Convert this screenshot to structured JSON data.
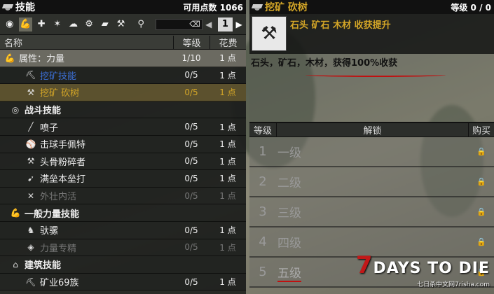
{
  "left": {
    "title": "技能",
    "points_label": "可用点数 1066",
    "page": "1",
    "headers": {
      "name": "名称",
      "level": "等级",
      "cost": "花费"
    },
    "rows": [
      {
        "name": "属性：力量",
        "level": "1/10",
        "cost": "1 点",
        "icon": "arm-icon",
        "type": "attr"
      },
      {
        "name": "挖矿技能",
        "level": "0/5",
        "cost": "1 点",
        "icon": "pickaxe-icon",
        "type": "blue"
      },
      {
        "name": "挖矿 砍树",
        "level": "0/5",
        "cost": "1 点",
        "icon": "axe-icon",
        "type": "gold"
      },
      {
        "name": "战斗技能",
        "level": "",
        "cost": "",
        "icon": "target-icon",
        "type": "cat"
      },
      {
        "name": "喷子",
        "level": "0/5",
        "cost": "1 点",
        "icon": "shotgun-icon",
        "type": "sub"
      },
      {
        "name": "击球手佩特",
        "level": "0/5",
        "cost": "1 点",
        "icon": "bat-icon",
        "type": "sub"
      },
      {
        "name": "头骨粉碎者",
        "level": "0/5",
        "cost": "1 点",
        "icon": "hammer-icon",
        "type": "sub"
      },
      {
        "name": "满垒本垒打",
        "level": "0/5",
        "cost": "1 点",
        "icon": "swing-icon",
        "type": "sub"
      },
      {
        "name": "外壮内活",
        "level": "0/5",
        "cost": "1 点",
        "icon": "cross-icon",
        "type": "dim"
      },
      {
        "name": "一般力量技能",
        "level": "",
        "cost": "",
        "icon": "arm-icon",
        "type": "cat"
      },
      {
        "name": "驮骡",
        "level": "0/5",
        "cost": "1 点",
        "icon": "mule-icon",
        "type": "sub"
      },
      {
        "name": "力量专精",
        "level": "0/5",
        "cost": "1 点",
        "icon": "gem-icon",
        "type": "dim"
      },
      {
        "name": "建筑技能",
        "level": "",
        "cost": "",
        "icon": "build-icon",
        "type": "cat"
      },
      {
        "name": "矿业69族",
        "level": "0/5",
        "cost": "1 点",
        "icon": "mine-icon",
        "type": "sub"
      }
    ]
  },
  "right": {
    "title": "挖矿 砍树",
    "level_label": "等级 0 / 0",
    "short_desc": "石头 矿石 木材 收获提升",
    "description": "石头，矿石，木材，获得100%收获",
    "headers": {
      "level": "等级",
      "unlock": "解锁",
      "buy": "购买"
    },
    "levels": [
      {
        "n": "1",
        "name": "一级"
      },
      {
        "n": "2",
        "name": "二级"
      },
      {
        "n": "3",
        "name": "三级"
      },
      {
        "n": "4",
        "name": "四级"
      },
      {
        "n": "5",
        "name": "五级"
      }
    ]
  },
  "logo": {
    "main_a": "7",
    "main_b": "DAYS TO DIE",
    "sub": "七日杀中文网7risha.com"
  }
}
